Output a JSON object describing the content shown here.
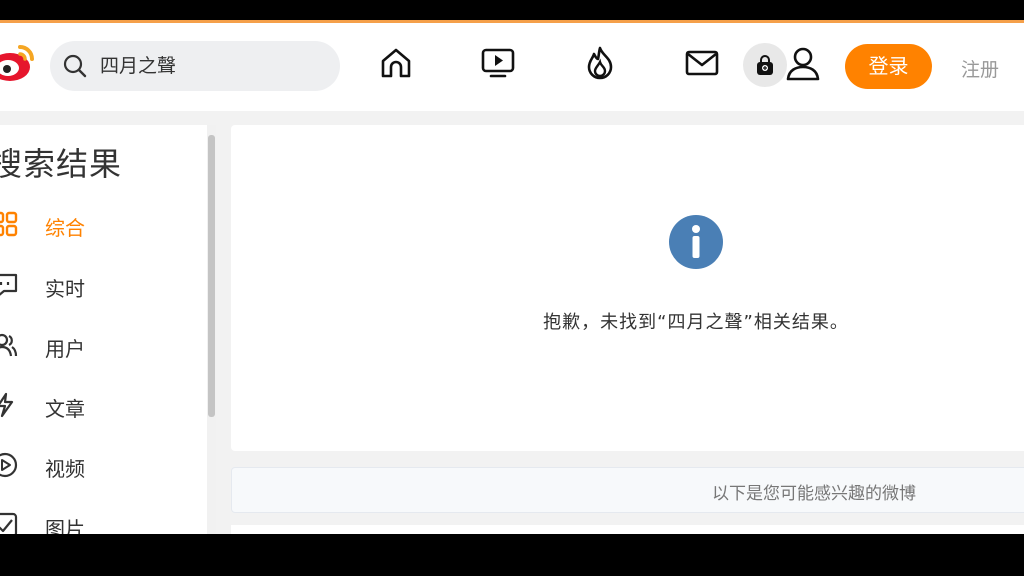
{
  "header": {
    "search_query": "四月之聲",
    "login_label": "登录",
    "register_label": "注册",
    "nav_icons": [
      "home-icon",
      "video-icon",
      "hot-icon",
      "mail-icon",
      "lock-icon",
      "user-icon"
    ]
  },
  "sidebar": {
    "title": "搜索结果",
    "items": [
      {
        "label": "综合",
        "icon": "grid-icon",
        "active": true
      },
      {
        "label": "实时",
        "icon": "chat-icon",
        "active": false
      },
      {
        "label": "用户",
        "icon": "users-icon",
        "active": false
      },
      {
        "label": "文章",
        "icon": "article-icon",
        "active": false
      },
      {
        "label": "视频",
        "icon": "play-icon",
        "active": false
      },
      {
        "label": "图片",
        "icon": "image-icon",
        "active": false
      }
    ]
  },
  "main": {
    "not_found_text": "抱歉，未找到“四月之聲”相关结果。",
    "suggestion_text": "以下是您可能感兴趣的微博"
  },
  "colors": {
    "accent": "#ff8200",
    "info_blue": "#4a7fb5",
    "top_line": "#f5a04a"
  }
}
